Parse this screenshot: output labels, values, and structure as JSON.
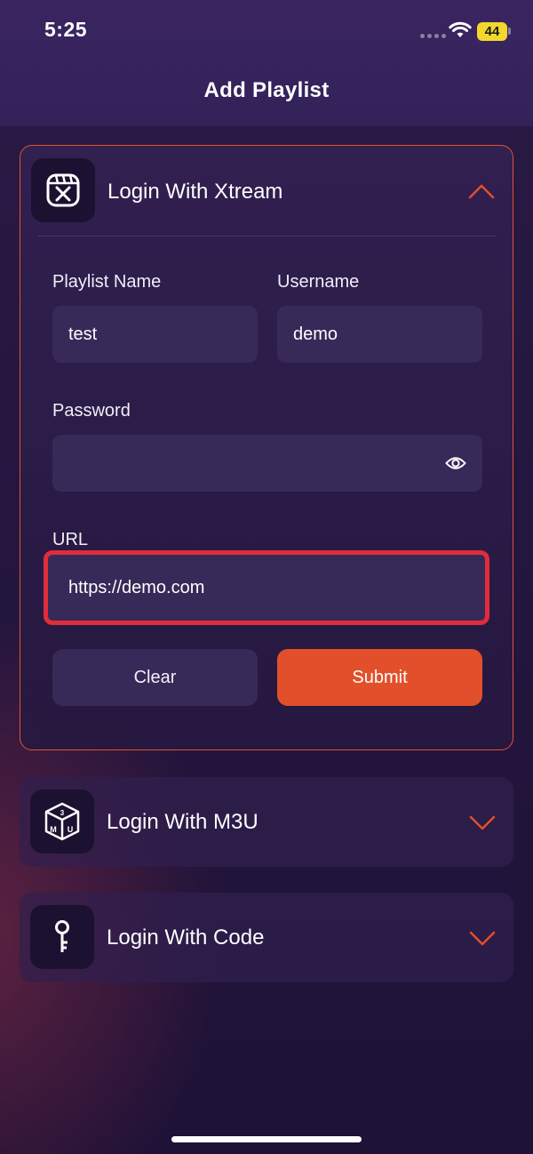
{
  "status_bar": {
    "time": "5:25",
    "battery": "44"
  },
  "header": {
    "title": "Add Playlist"
  },
  "xtream": {
    "title": "Login With Xtream",
    "playlist_name_label": "Playlist Name",
    "playlist_name_value": "test",
    "username_label": "Username",
    "username_value": "demo",
    "password_label": "Password",
    "password_value": "",
    "url_label": "URL",
    "url_value": "https://demo.com",
    "clear_label": "Clear",
    "submit_label": "Submit"
  },
  "m3u": {
    "title": "Login With M3U",
    "icon_text": "M3U"
  },
  "code": {
    "title": "Login With Code"
  },
  "colors": {
    "accent": "#e1502a",
    "highlight": "#e12c3a",
    "field_bg": "#372a59",
    "battery": "#f3d72c"
  },
  "icons": [
    "xtream-icon",
    "m3u-cube-icon",
    "key-icon",
    "chevron-up-icon",
    "chevron-down-icon",
    "eye-icon",
    "wifi-icon"
  ]
}
